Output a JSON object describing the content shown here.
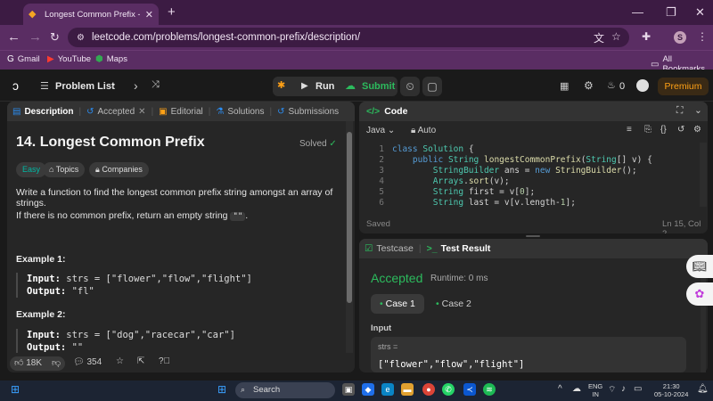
{
  "browser": {
    "tab_title": "Longest Common Prefix - LeetCode",
    "url": "leetcode.com/problems/longest-common-prefix/description/",
    "profile_initial": "S",
    "bookmarks": [
      "Gmail",
      "YouTube",
      "Maps"
    ],
    "all_bookmarks": "All Bookmarks"
  },
  "nav": {
    "problem_list": "Problem List",
    "run": "Run",
    "submit": "Submit",
    "streak": "0",
    "premium": "Premium"
  },
  "left_tabs": [
    "Description",
    "Accepted",
    "Editorial",
    "Solutions",
    "Submissions"
  ],
  "problem": {
    "title": "14. Longest Common Prefix",
    "status": "Solved",
    "difficulty": "Easy",
    "topics": "Topics",
    "companies": "Companies",
    "desc1": "Write a function to find the longest common prefix string amongst an array of strings.",
    "desc2_pre": "If there is no common prefix, return an empty string",
    "desc2_code": "\"\"",
    "desc2_post": ".",
    "examples": [
      {
        "heading": "Example 1:",
        "input_label": "Input:",
        "input": "strs = [\"flower\",\"flow\",\"flight\"]",
        "output_label": "Output:",
        "output": "\"fl\""
      },
      {
        "heading": "Example 2:",
        "input_label": "Input:",
        "input": "strs = [\"dog\",\"racecar\",\"car\"]",
        "output_label": "Output:",
        "output": "\"\""
      }
    ],
    "likes": "18K",
    "comments": "354"
  },
  "code": {
    "tab": "Code",
    "language": "Java",
    "mode": "Auto",
    "saved": "Saved",
    "cursor": "Ln 15, Col 2",
    "line_numbers": [
      "1",
      "2",
      "3",
      "4",
      "5",
      "6"
    ]
  },
  "result": {
    "tab_testcase": "Testcase",
    "tab_result": "Test Result",
    "verdict": "Accepted",
    "runtime": "Runtime: 0 ms",
    "case1": "Case 1",
    "case2": "Case 2",
    "input_label": "Input",
    "var_label": "strs =",
    "value": "[\"flower\",\"flow\",\"flight\"]"
  },
  "taskbar": {
    "search": "Search",
    "lang": "ENG",
    "region": "IN",
    "time": "21:30",
    "date": "05-10-2024"
  }
}
